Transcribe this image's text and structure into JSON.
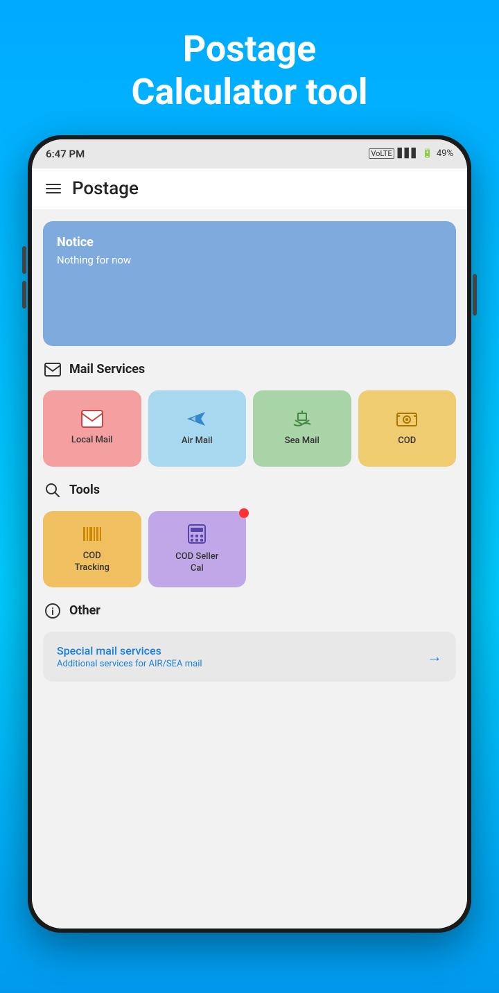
{
  "app": {
    "title": "Postage\nCalculator tool",
    "header_title": "Postage"
  },
  "status_bar": {
    "time": "6:47 PM",
    "battery": "49%",
    "signal": "▋▋▋"
  },
  "notice": {
    "title": "Notice",
    "text": "Nothing for now"
  },
  "mail_services": {
    "section_title": "Mail Services",
    "items": [
      {
        "id": "local-mail",
        "label": "Local Mail",
        "color": "pink"
      },
      {
        "id": "air-mail",
        "label": "Air Mail",
        "color": "light-blue"
      },
      {
        "id": "sea-mail",
        "label": "Sea Mail",
        "color": "green"
      },
      {
        "id": "cod",
        "label": "COD",
        "color": "yellow"
      }
    ]
  },
  "tools": {
    "section_title": "Tools",
    "items": [
      {
        "id": "cod-tracking",
        "label": "COD\nTracking",
        "color": "orange",
        "has_notification": false
      },
      {
        "id": "cod-seller-cal",
        "label": "COD Seller\nCal",
        "color": "purple",
        "has_notification": true
      }
    ]
  },
  "other": {
    "section_title": "Other",
    "card_title": "Special mail services",
    "card_subtitle": "Additional services for AIR/SEA mail"
  }
}
